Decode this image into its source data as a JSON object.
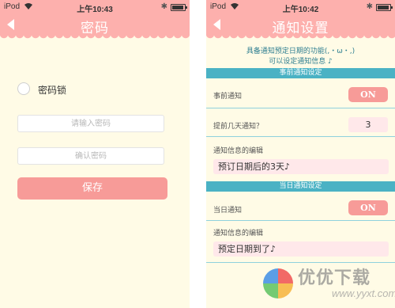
{
  "colors": {
    "header_pink": "#fdb0ad",
    "button_pink": "#f79b98",
    "teal": "#4ab2c4",
    "cream": "#fffbe6",
    "field_pink": "#ffe8ea"
  },
  "left_screen": {
    "status": {
      "carrier": "iPod",
      "time": "上午10:43",
      "battery_level": 0.85
    },
    "title": "密码",
    "lock_label": "密码锁",
    "password_placeholder": "请输入密码",
    "confirm_placeholder": "确认密码",
    "save_label": "保存"
  },
  "right_screen": {
    "status": {
      "carrier": "iPod",
      "time": "上午10:42",
      "battery_level": 0.85
    },
    "title": "通知设置",
    "intro_line1": "具备通知预定日期的功能(,・ω・,)",
    "intro_line2": "可以设定通知信息 ♪",
    "advance_section": {
      "header": "事前通知设定",
      "toggle_label": "事前通知",
      "toggle_value": "ON",
      "days_label": "提前几天通知？",
      "days_value": "3",
      "message_label": "通知信息的编辑",
      "message_value": "预订日期后的3天♪"
    },
    "same_day_section": {
      "header": "当日通知设定",
      "toggle_label": "当日通知",
      "toggle_value": "ON",
      "message_label": "通知信息的编辑",
      "message_value": "预定日期到了♪"
    }
  },
  "watermark": {
    "text": "优优下载",
    "sub": "www.yyxt.com"
  }
}
